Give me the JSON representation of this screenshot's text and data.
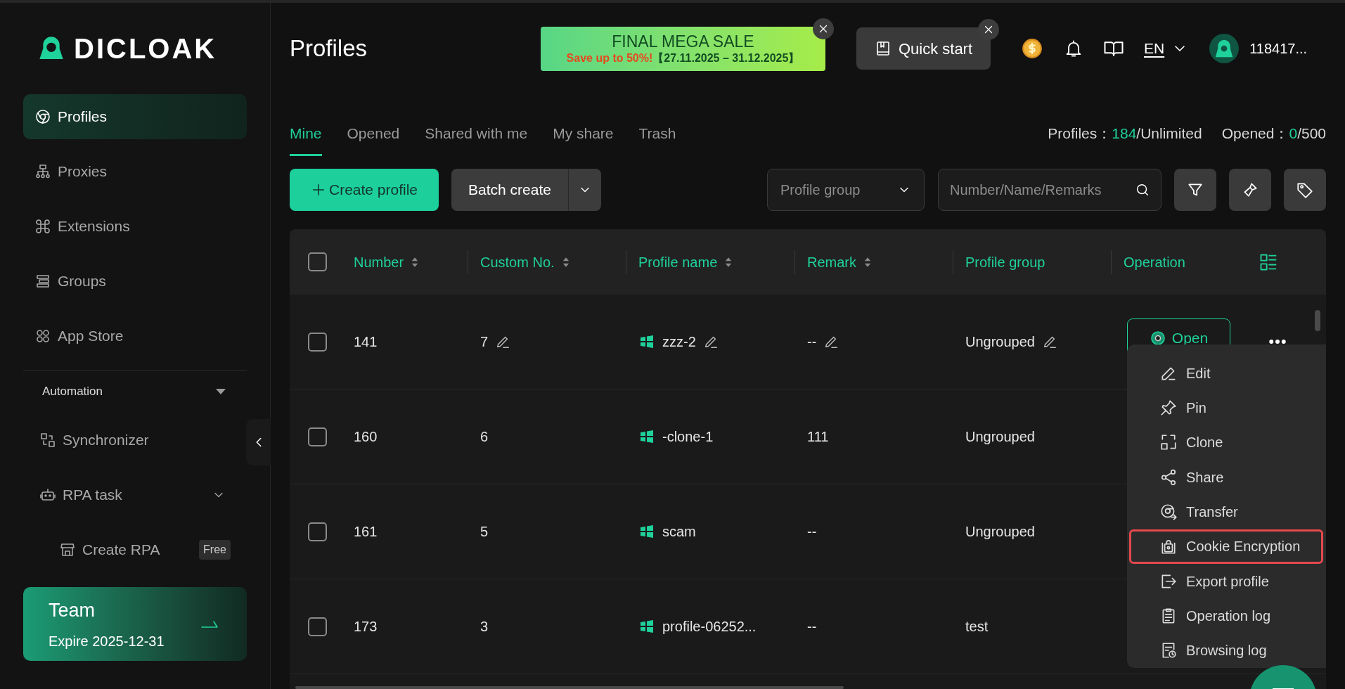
{
  "logo": {
    "text": "DICLOAK"
  },
  "sidebar": {
    "items": [
      {
        "label": "Profiles",
        "selected": true
      },
      {
        "label": "Proxies",
        "selected": false
      },
      {
        "label": "Extensions",
        "selected": false
      },
      {
        "label": "Groups",
        "selected": false
      },
      {
        "label": "App Store",
        "selected": false
      }
    ],
    "section": {
      "title": "Automation",
      "expanded": true
    },
    "automation_items": [
      {
        "label": "Synchronizer"
      },
      {
        "label": "RPA task",
        "expanded": false
      }
    ],
    "sub_items": [
      {
        "label": "Create RPA",
        "badge": "Free"
      }
    ],
    "plan": {
      "name": "Team",
      "expire": "Expire 2025-12-31"
    }
  },
  "header": {
    "title": "Profiles",
    "sale": {
      "title": "FINAL MEGA SALE",
      "highlight": "Save up to 50%!",
      "dates": "【27.11.2025 – 31.12.2025】"
    },
    "quick_start": "Quick start",
    "language": "EN",
    "user": "118417..."
  },
  "tabs": [
    {
      "label": "Mine",
      "selected": true
    },
    {
      "label": "Opened",
      "selected": false
    },
    {
      "label": "Shared with me",
      "selected": false
    },
    {
      "label": "My share",
      "selected": false
    },
    {
      "label": "Trash",
      "selected": false
    }
  ],
  "stats": [
    {
      "label": "Profiles：",
      "value": "184",
      "limit": "/Unlimited"
    },
    {
      "label": "Opened：",
      "value": "0",
      "limit": "/500"
    }
  ],
  "toolbar": {
    "create": "Create profile",
    "batch": "Batch create",
    "group_placeholder": "Profile group",
    "search_placeholder": "Number/Name/Remarks"
  },
  "table": {
    "all_checked": false,
    "columns": [
      {
        "label": "Number",
        "sortable": true
      },
      {
        "label": "Custom No.",
        "sortable": true
      },
      {
        "label": "Profile name",
        "sortable": true
      },
      {
        "label": "Remark",
        "sortable": true
      },
      {
        "label": "Profile group",
        "sortable": false
      },
      {
        "label": "Operation",
        "sortable": false
      }
    ],
    "rows": [
      {
        "checked": false,
        "number": "141",
        "custom": "7",
        "name": "zzz-2",
        "remark": "--",
        "group": "Ungrouped",
        "editable": true,
        "open": "Open"
      },
      {
        "checked": false,
        "number": "160",
        "custom": "6",
        "name": "-clone-1",
        "remark": "111",
        "group": "Ungrouped",
        "editable": false
      },
      {
        "checked": false,
        "number": "161",
        "custom": "5",
        "name": "scam",
        "remark": "--",
        "group": "Ungrouped",
        "editable": false
      },
      {
        "checked": false,
        "number": "173",
        "custom": "3",
        "name": "profile-06252...",
        "remark": "--",
        "group": "test",
        "editable": false
      }
    ]
  },
  "menu": [
    {
      "label": "Edit",
      "highlighted": false
    },
    {
      "label": "Pin",
      "highlighted": false
    },
    {
      "label": "Clone",
      "highlighted": false
    },
    {
      "label": "Share",
      "highlighted": false
    },
    {
      "label": "Transfer",
      "highlighted": false
    },
    {
      "label": "Cookie Encryption",
      "highlighted": true
    },
    {
      "label": "Export profile",
      "highlighted": false
    },
    {
      "label": "Operation log",
      "highlighted": false
    },
    {
      "label": "Browsing log",
      "highlighted": false
    }
  ]
}
